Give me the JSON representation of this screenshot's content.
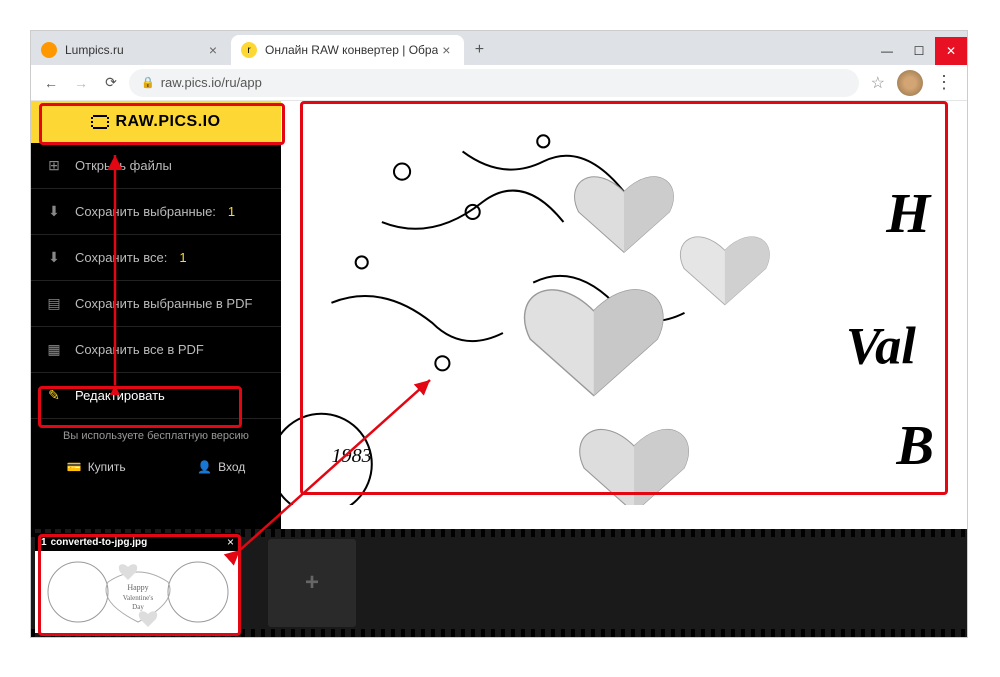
{
  "window": {
    "tabs": [
      {
        "label": "Lumpics.ru",
        "active": false
      },
      {
        "label": "Онлайн RAW конвертер | Обра",
        "active": true
      }
    ],
    "url": "raw.pics.io/ru/app"
  },
  "logo": "RAW.PICS.IO",
  "sidebar": {
    "items": [
      {
        "icon": "plus",
        "label": "Открыть файлы"
      },
      {
        "icon": "download",
        "label": "Сохранить выбранные:",
        "count": "1"
      },
      {
        "icon": "download-all",
        "label": "Сохранить все:",
        "count": "1"
      },
      {
        "icon": "pdf",
        "label": "Сохранить выбранные в PDF"
      },
      {
        "icon": "pdf-grid",
        "label": "Сохранить все в PDF"
      },
      {
        "icon": "pencil",
        "label": "Редактировать",
        "highlight": true
      }
    ],
    "free_message": "Вы используете бесплатную версию",
    "buy": "Купить",
    "login": "Вход"
  },
  "preview": {
    "year_text": "1983"
  },
  "thumbnail": {
    "num": "1",
    "name": "converted-to-jpg.jpg",
    "caption": "Happy Valentine's Day"
  }
}
